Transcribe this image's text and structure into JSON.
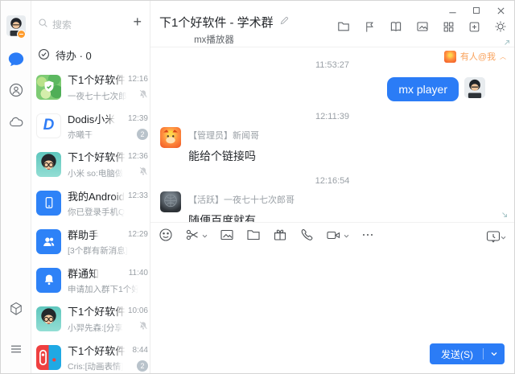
{
  "colors": {
    "accent": "#2b7cf6",
    "mention": "#f9a25c",
    "badge": "#b9c3cb"
  },
  "icons": [
    "search-icon",
    "plus-icon",
    "todo-check-icon",
    "chat-bubble-icon",
    "contacts-icon",
    "cloud-icon",
    "workspace-cube-icon",
    "menu-icon",
    "mute-icon",
    "edit-pencil-icon",
    "folder-icon",
    "flag-icon",
    "notebook-icon",
    "image-icon",
    "apps-grid-icon",
    "add-window-icon",
    "settings-gear-icon",
    "minimize-icon",
    "maximize-icon",
    "close-icon",
    "emoji-icon",
    "scissors-icon",
    "gift-icon",
    "phone-icon",
    "video-icon",
    "more-icon",
    "chat-history-icon",
    "chevron-down-icon"
  ],
  "chat_list": {
    "search_placeholder": "搜索",
    "add_label": "+",
    "todo_label": "待办 · 0",
    "items": [
      {
        "title": "下1个好软件",
        "subtitle": "一夜七十七次郎",
        "time": "12:16",
        "muted": true
      },
      {
        "title": "Dodis小米",
        "subtitle": "亦曦干",
        "time": "12:39",
        "badge": "2"
      },
      {
        "title": "下1个好软件",
        "subtitle": "小米 so:电脑做",
        "time": "12:36",
        "muted": true
      },
      {
        "title": "我的Android",
        "subtitle": "你已登录手机Q",
        "time": "12:33"
      },
      {
        "title": "群助手",
        "subtitle": "[3个群有新消息]",
        "time": "12:29"
      },
      {
        "title": "群通知",
        "subtitle": "申请加入群下1个好",
        "time": "11:40"
      },
      {
        "title": "下1个好软件",
        "subtitle": "小羿先森:[分享",
        "time": "10:06",
        "muted": true
      },
      {
        "title": "下1个好软件",
        "subtitle": "Cris:[动画表情]",
        "time": "8:44",
        "badge": "2"
      }
    ]
  },
  "header": {
    "title": "下1个好软件 - 学术群",
    "subtitle": "mx播放器"
  },
  "chat": {
    "mention_notice": "有人@我",
    "messages": [
      {
        "type": "time",
        "text": "11:53:27"
      },
      {
        "type": "sent",
        "text": "mx player"
      },
      {
        "type": "time",
        "text": "12:11:39"
      },
      {
        "type": "received",
        "sender": "【管理员】新闻哥",
        "text": "能给个链接吗"
      },
      {
        "type": "time",
        "text": "12:16:54"
      },
      {
        "type": "received",
        "sender": "【活跃】一夜七十七次郎哥",
        "text": "随便百度就有"
      }
    ]
  },
  "composer": {
    "send_label": "发送(S)"
  }
}
